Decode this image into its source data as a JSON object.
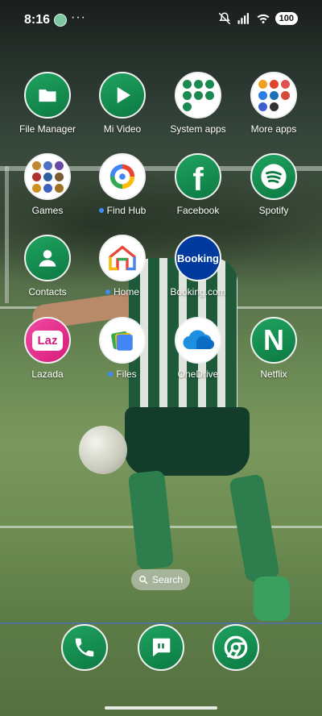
{
  "status_bar": {
    "time": "8:16",
    "more": "···",
    "battery": "100"
  },
  "apps": [
    {
      "label": "File Manager",
      "icon": "folder-icon",
      "new": false
    },
    {
      "label": "Mi Video",
      "icon": "play-icon",
      "new": false
    },
    {
      "label": "System apps",
      "icon": "folder-grid-icon",
      "new": false
    },
    {
      "label": "More apps",
      "icon": "folder-grid-icon",
      "new": false
    },
    {
      "label": "Games",
      "icon": "folder-grid-icon",
      "new": false
    },
    {
      "label": "Find Hub",
      "icon": "find-hub-icon",
      "new": true
    },
    {
      "label": "Facebook",
      "icon": "facebook-icon",
      "new": false
    },
    {
      "label": "Spotify",
      "icon": "spotify-icon",
      "new": false
    },
    {
      "label": "Contacts",
      "icon": "person-icon",
      "new": false
    },
    {
      "label": "Home",
      "icon": "google-home-icon",
      "new": true
    },
    {
      "label": "Booking.com",
      "icon": "booking-icon",
      "booking_text": "Booking",
      "new": false
    },
    {
      "label": "",
      "icon": "empty",
      "new": false
    },
    {
      "label": "Lazada",
      "icon": "lazada-icon",
      "lazada_text": "Laz",
      "new": false
    },
    {
      "label": "Files",
      "icon": "files-icon",
      "new": true
    },
    {
      "label": "OneDrive",
      "icon": "onedrive-icon",
      "new": false
    },
    {
      "label": "Netflix",
      "icon": "netflix-icon",
      "netflix_text": "N",
      "new": false
    }
  ],
  "search": {
    "label": "Search"
  },
  "dock": [
    {
      "icon": "phone-icon"
    },
    {
      "icon": "messages-icon"
    },
    {
      "icon": "chrome-icon"
    }
  ],
  "colors": {
    "accent_green": "#0c7a43",
    "new_dot": "#3d8bff"
  }
}
